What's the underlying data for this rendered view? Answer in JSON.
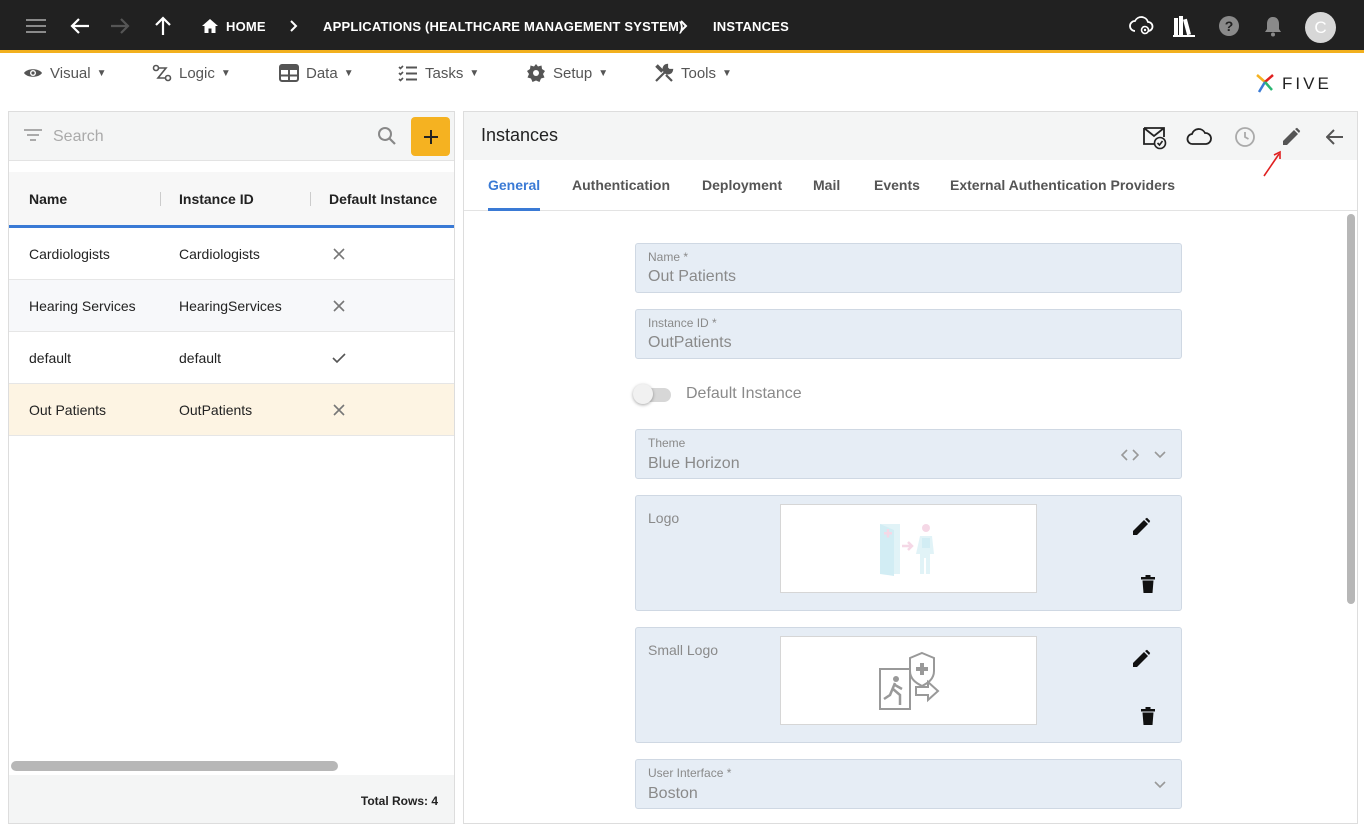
{
  "topbar": {
    "breadcrumb": [
      "HOME",
      "APPLICATIONS (HEALTHCARE MANAGEMENT SYSTEM)",
      "INSTANCES"
    ],
    "avatar_initial": "C"
  },
  "menu": {
    "items": [
      {
        "label": "Visual",
        "icon": "eye-icon"
      },
      {
        "label": "Logic",
        "icon": "logic-icon"
      },
      {
        "label": "Data",
        "icon": "table-icon"
      },
      {
        "label": "Tasks",
        "icon": "tasks-icon"
      },
      {
        "label": "Setup",
        "icon": "gear-icon"
      },
      {
        "label": "Tools",
        "icon": "tools-icon"
      }
    ],
    "caret": "▼"
  },
  "brand": {
    "name": "FIVE"
  },
  "list": {
    "search_placeholder": "Search",
    "columns": [
      "Name",
      "Instance ID",
      "Default Instance"
    ],
    "rows": [
      {
        "name": "Cardiologists",
        "instance_id": "Cardiologists",
        "default": false
      },
      {
        "name": "Hearing Services",
        "instance_id": "HearingServices",
        "default": false
      },
      {
        "name": "default",
        "instance_id": "default",
        "default": true
      },
      {
        "name": "Out Patients",
        "instance_id": "OutPatients",
        "default": false
      }
    ],
    "selected_index": 3,
    "total_rows": "Total Rows: 4"
  },
  "form": {
    "title": "Instances",
    "tabs": [
      "General",
      "Authentication",
      "Deployment",
      "Mail",
      "Events",
      "External Authentication Providers"
    ],
    "active_tab": 0,
    "name_label": "Name *",
    "name_value": "Out Patients",
    "instance_id_label": "Instance ID *",
    "instance_id_value": "OutPatients",
    "default_instance_label": "Default Instance",
    "default_instance_on": false,
    "theme_label": "Theme",
    "theme_value": "Blue Horizon",
    "logo_label": "Logo",
    "small_logo_label": "Small Logo",
    "user_interface_label": "User Interface *",
    "user_interface_value": "Boston"
  },
  "colors": {
    "accent": "#3a7ad5",
    "brand_yellow": "#f5b221",
    "selected_row": "#fdf4e3",
    "annotation_arrow": "#e02020"
  }
}
